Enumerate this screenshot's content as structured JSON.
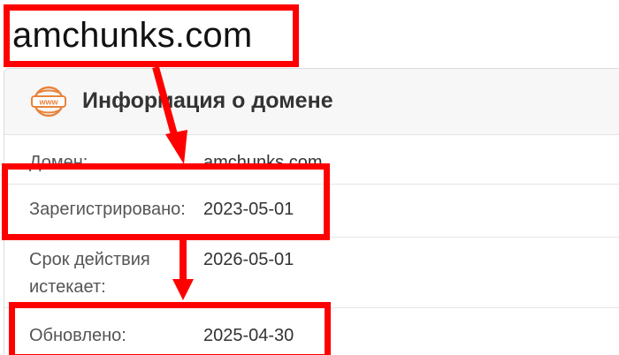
{
  "page": {
    "domain_title": "amchunks.com"
  },
  "card": {
    "title": "Информация о домене",
    "icon": "www-globe-icon",
    "icon_text": "www",
    "rows": [
      {
        "label": "Домен:",
        "value": "amchunks.com"
      },
      {
        "label": "Зарегистрировано:",
        "value": "2023-05-01"
      },
      {
        "label": "Срок действия истекает:",
        "label_line1": "Срок действия",
        "label_line2": "истекает:",
        "value": "2026-05-01"
      },
      {
        "label": "Обновлено:",
        "value": "2025-04-30"
      }
    ]
  },
  "colors": {
    "highlight": "#ff0000",
    "header_bg": "#f7f7f7",
    "icon_accent": "#e8833a"
  }
}
